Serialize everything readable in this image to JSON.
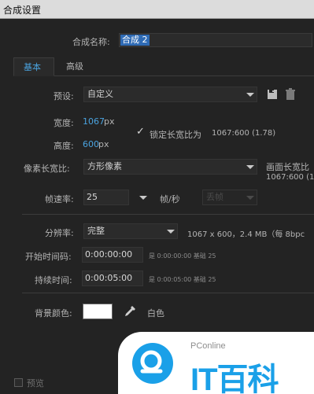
{
  "window": {
    "title": "合成设置"
  },
  "comp_name": {
    "label": "合成名称:",
    "value": "合成 2"
  },
  "tabs": [
    {
      "label": "基本"
    },
    {
      "label": "高级"
    }
  ],
  "preset": {
    "label": "预设:",
    "value": "自定义"
  },
  "width": {
    "label": "宽度:",
    "value": "1067",
    "unit": "px"
  },
  "height": {
    "label": "高度:",
    "value": "600",
    "unit": "px"
  },
  "lock_aspect": {
    "label": "锁定长宽比为",
    "value": "1067:600 (1.78)",
    "checked": true
  },
  "pixel_aspect": {
    "label": "像素长宽比:",
    "value": "方形像素",
    "frame_aspect_label": "画面长宽比",
    "frame_aspect_value": "1067:600 (1"
  },
  "frame_rate": {
    "label": "帧速率:",
    "value": "25",
    "unit": "帧/秒",
    "drop_frame": "丢帧"
  },
  "resolution": {
    "label": "分辨率:",
    "value": "完整",
    "info": "1067 x 600，2.4 MB（每 8bpc"
  },
  "start_timecode": {
    "label": "开始时间码:",
    "value": "0:00:00:00",
    "info": "是 0:00:00:00  基础 25"
  },
  "duration": {
    "label": "持续时间:",
    "value": "0:00:05:00",
    "info": "是 0:00:05:00  基础 25"
  },
  "background_color": {
    "label": "背景颜色:",
    "name": "白色",
    "color": "#ffffff"
  },
  "preview": {
    "label": "预览"
  },
  "watermark": {
    "brand_small": "PConline",
    "brand_large": "IT百科"
  },
  "icons": {
    "save_preset": "save-icon",
    "delete_preset": "trash-icon",
    "eyedropper": "eyedropper-icon"
  }
}
